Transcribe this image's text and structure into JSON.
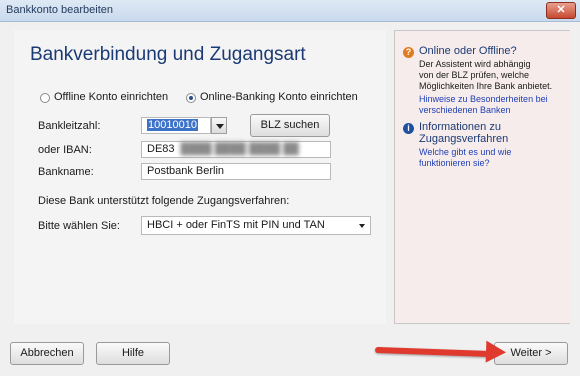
{
  "window": {
    "title": "Bankkonto bearbeiten",
    "close_glyph": "✕"
  },
  "main": {
    "heading": "Bankverbindung und Zugangsart",
    "radio_offline": "Offline Konto einrichten",
    "radio_online": "Online-Banking Konto einrichten",
    "selected_mode": "online",
    "blz_label": "Bankleitzahl:",
    "blz_value": "10010010",
    "blz_search_button": "BLZ suchen",
    "iban_label": "oder IBAN:",
    "iban_value": "DE83",
    "bank_label": "Bankname:",
    "bank_value": "Postbank Berlin",
    "supports_text": "Diese Bank unterstützt folgende Zugangsverfahren:",
    "choose_label": "Bitte wählen Sie:",
    "choose_value": "HBCI + oder FinTS mit PIN und TAN"
  },
  "help": {
    "section1_title": "Online oder Offline?",
    "section1_text1": "Der Assistent wird abhängig",
    "section1_text2": "von der BLZ prüfen, welche",
    "section1_text3": "Möglichkeiten Ihre Bank anbietet.",
    "section1_link1": "Hinweise zu Besonderheiten bei",
    "section1_link2": "verschiedenen Banken",
    "section2_title1": "Informationen zu",
    "section2_title2": "Zugangsverfahren",
    "section2_link1": "Welche gibt es und wie",
    "section2_link2": "funktionieren sie?"
  },
  "footer": {
    "cancel_button": "Abbrechen",
    "help_button": "Hilfe",
    "next_button": "Weiter >"
  },
  "colors": {
    "accent": "#1b3a74",
    "arrow": "#e03a2e",
    "help_question": "#e07b1f",
    "help_info": "#1f4fa0"
  }
}
